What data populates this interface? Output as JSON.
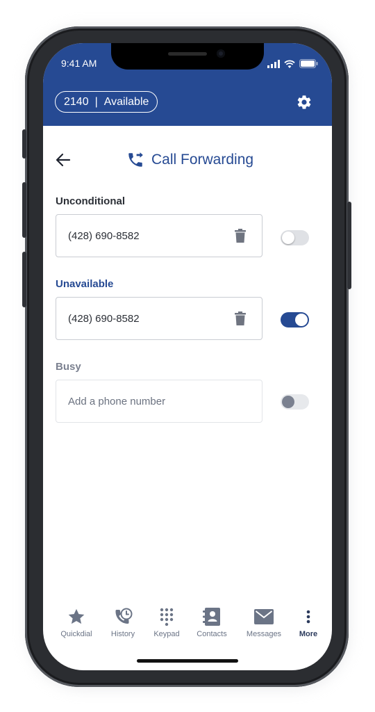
{
  "status_bar": {
    "time": "9:41 AM"
  },
  "header": {
    "extension": "2140",
    "separator": "|",
    "presence": "Available",
    "background_color": "#264a93",
    "settings_icon": "gear-icon"
  },
  "page": {
    "back_icon": "arrow-left-icon",
    "title_icon": "call-forward-icon",
    "title": "Call Forwarding"
  },
  "sections": [
    {
      "label": "Unconditional",
      "label_color": "#2b2f36",
      "number": "(428) 690-8582",
      "enabled": false
    },
    {
      "label": "Unavailable",
      "label_color": "#264a93",
      "number": "(428) 690-8582",
      "enabled": true
    },
    {
      "label": "Busy",
      "label_color": "#7b8190",
      "placeholder": "Add a phone number",
      "enabled": false
    }
  ],
  "tabs": [
    {
      "label": "Quickdial",
      "icon": "star-icon"
    },
    {
      "label": "History",
      "icon": "phone-history-icon"
    },
    {
      "label": "Keypad",
      "icon": "keypad-icon"
    },
    {
      "label": "Contacts",
      "icon": "contacts-book-icon"
    },
    {
      "label": "Messages",
      "icon": "envelope-icon"
    },
    {
      "label": "More",
      "icon": "more-vertical-icon",
      "active": true
    }
  ],
  "colors": {
    "accent": "#264a93",
    "tab_inactive": "#6b7486",
    "tab_active": "#2b3a5c"
  }
}
